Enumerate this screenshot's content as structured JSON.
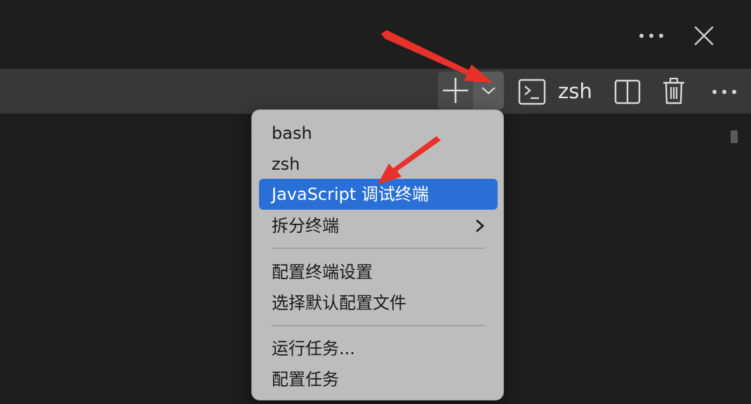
{
  "titlebar": {
    "more_icon": "ellipsis-icon",
    "close_icon": "close-icon"
  },
  "toolbar": {
    "new_terminal_icon": "plus-icon",
    "dropdown_icon": "chevron-down-icon",
    "terminal_icon": "terminal-icon",
    "terminal_name": "zsh",
    "split_icon": "split-icon",
    "delete_icon": "trash-icon",
    "more_icon": "ellipsis-icon"
  },
  "menu": {
    "items": [
      {
        "label": "bash"
      },
      {
        "label": "zsh"
      },
      {
        "label": "JavaScript 调试终端",
        "selected": true
      },
      {
        "label": "拆分终端",
        "submenu": true
      },
      {
        "label": "配置终端设置"
      },
      {
        "label": "选择默认配置文件"
      },
      {
        "label": "运行任务..."
      },
      {
        "label": "配置任务"
      }
    ]
  },
  "colors": {
    "background": "#1e1e1e",
    "toolbar": "#383838",
    "menu_bg": "#bdbdbd",
    "selected": "#2a6fd6",
    "annotation_arrow": "#e8312a"
  }
}
